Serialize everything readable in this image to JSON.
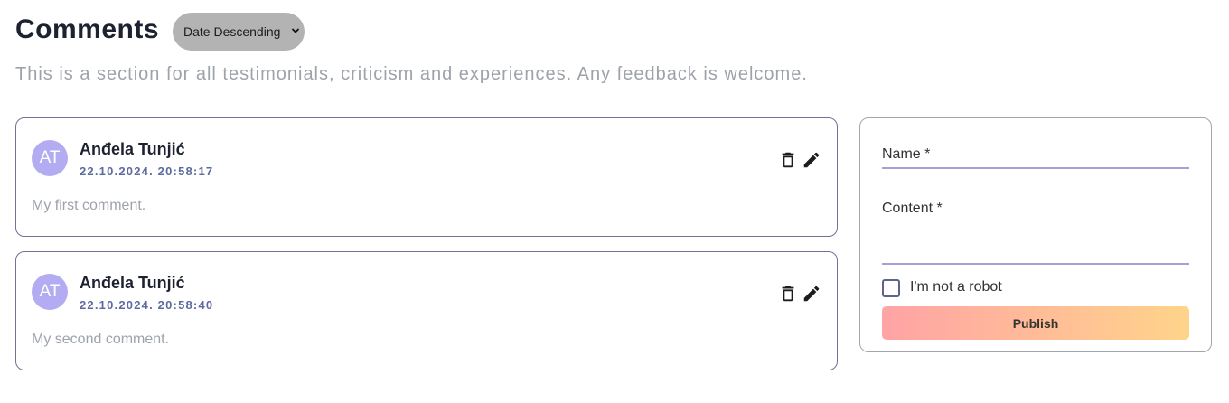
{
  "header": {
    "title": "Comments",
    "sort": {
      "selected": "Date Descending"
    },
    "subtitle": "This is a section for all testimonials, criticism and experiences. Any feedback is welcome."
  },
  "comments": [
    {
      "initials": "AT",
      "author": "Anđela Tunjić",
      "timestamp": "22.10.2024. 20:58:17",
      "text": "My first comment."
    },
    {
      "initials": "AT",
      "author": "Anđela Tunjić",
      "timestamp": "22.10.2024. 20:58:40",
      "text": "My second comment."
    }
  ],
  "icons": {
    "delete": "trash-icon",
    "edit": "pencil-icon",
    "sort": "chevron-down-icon"
  },
  "form": {
    "name_label": "Name *",
    "content_label": "Content *",
    "robot_label": "I'm not a robot",
    "robot_checked": false,
    "publish_label": "Publish"
  },
  "colors": {
    "avatar": "#b3acf2",
    "card_border": "#6e7397",
    "timestamp": "#5d6aa0",
    "field_underline": "#a6a2d8",
    "publish_gradient_start": "#ffa3a5",
    "publish_gradient_end": "#ffd48a"
  }
}
